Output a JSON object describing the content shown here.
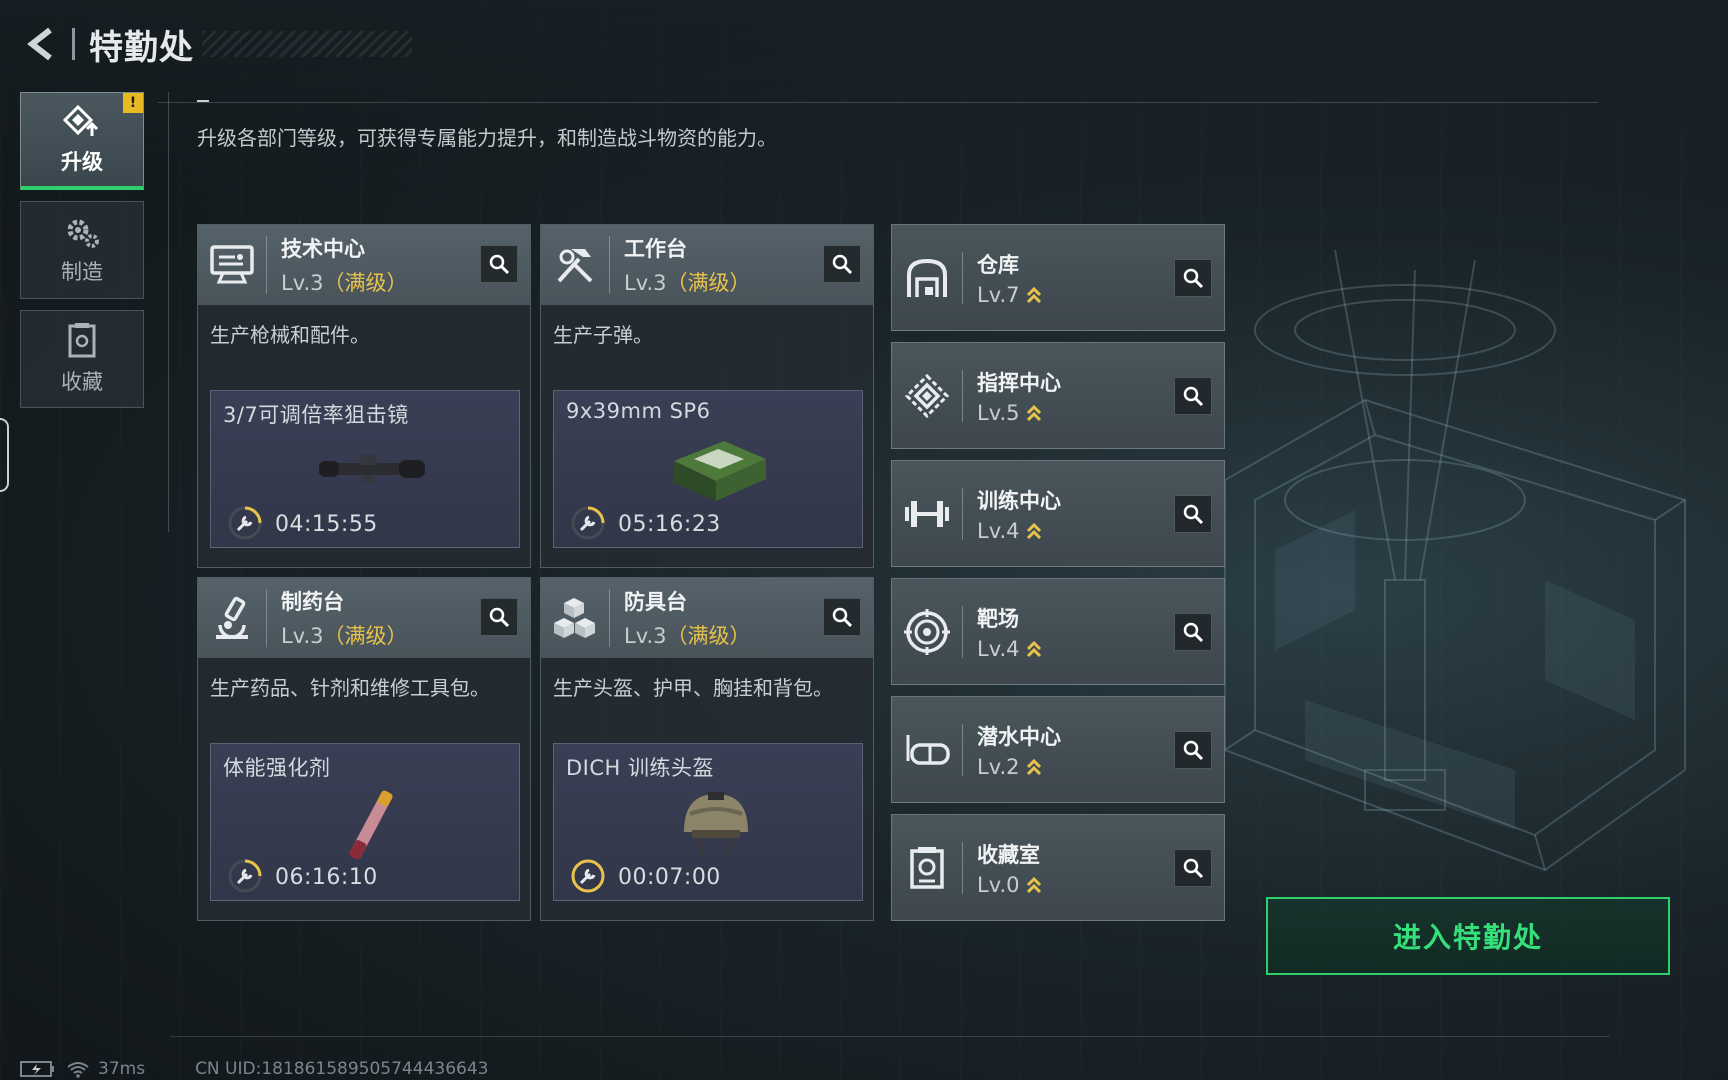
{
  "header": {
    "title": "特勤处"
  },
  "sidenav": {
    "items": [
      {
        "label": "升级",
        "icon": "upgrade-icon",
        "active": true,
        "badge": "!"
      },
      {
        "label": "制造",
        "icon": "gear-icon",
        "active": false
      },
      {
        "label": "收藏",
        "icon": "collection-icon",
        "active": false
      }
    ]
  },
  "description": "升级各部门等级，可获得专属能力提升，和制造战斗物资的能力。",
  "big_cards": [
    {
      "title": "技术中心",
      "level": "Lv.3",
      "max": "（满级）",
      "desc": "生产枪械和配件。",
      "craft_name": "3/7可调倍率狙击镜",
      "craft_time": "04:15:55",
      "icon": "monitor-icon"
    },
    {
      "title": "工作台",
      "level": "Lv.3",
      "max": "（满级）",
      "desc": "生产子弹。",
      "craft_name": "9x39mm SP6",
      "craft_time": "05:16:23",
      "icon": "hammer-wrench-icon"
    },
    {
      "title": "制药台",
      "level": "Lv.3",
      "max": "（满级）",
      "desc": "生产药品、针剂和维修工具包。",
      "craft_name": "体能强化剂",
      "craft_time": "06:16:10",
      "icon": "microscope-icon"
    },
    {
      "title": "防具台",
      "level": "Lv.3",
      "max": "（满级）",
      "desc": "生产头盔、护甲、胸挂和背包。",
      "craft_name": "DICH 训练头盔",
      "craft_time": "00:07:00",
      "icon": "blocks-icon"
    }
  ],
  "small_cards": [
    {
      "title": "仓库",
      "level": "Lv.7",
      "icon": "warehouse-icon"
    },
    {
      "title": "指挥中心",
      "level": "Lv.5",
      "icon": "command-icon"
    },
    {
      "title": "训练中心",
      "level": "Lv.4",
      "icon": "dumbbell-icon"
    },
    {
      "title": "靶场",
      "level": "Lv.4",
      "icon": "target-icon"
    },
    {
      "title": "潜水中心",
      "level": "Lv.2",
      "icon": "diving-mask-icon"
    },
    {
      "title": "收藏室",
      "level": "Lv.0",
      "icon": "collection-room-icon"
    }
  ],
  "enter_button": "进入特勤处",
  "footer": {
    "ping": "37ms",
    "uid": "CN UID:18186158950574443​6643"
  },
  "colors": {
    "accent_green": "#2fd06b",
    "max_gold": "#e8c24a",
    "upgrade_gold": "#e8c24a"
  }
}
